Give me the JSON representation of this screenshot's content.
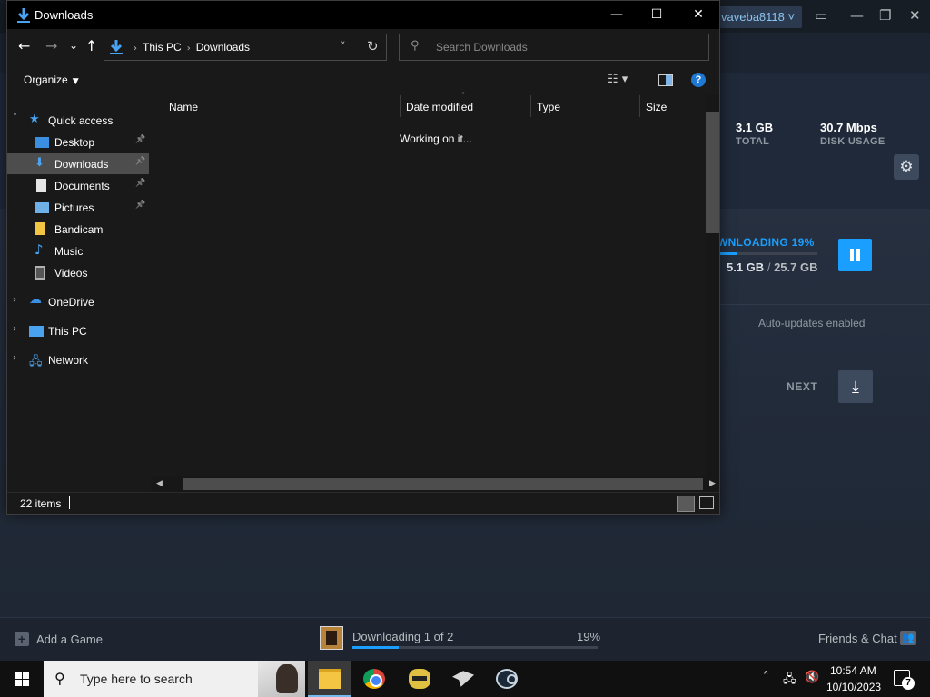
{
  "steam": {
    "username": "vaveba8118",
    "window_controls": [
      "—",
      "❐",
      "✕"
    ],
    "stats": [
      {
        "value": "3.1 GB",
        "label": "TOTAL"
      },
      {
        "value": "30.7 Mbps",
        "label": "DISK USAGE"
      }
    ],
    "downloading_label": "WNLOADING 19%",
    "downloaded_size": "5.1 GB",
    "size_separator": "/",
    "total_size": "25.7 GB",
    "progress_fraction": 0.19,
    "auto_updates": "Auto-updates enabled",
    "next_label": "NEXT",
    "bottom": {
      "add_game": "Add a Game",
      "downloading_status": "Downloading 1 of 2",
      "percent": "19%",
      "friends_chat": "Friends & Chat"
    },
    "colors": {
      "accent": "#1a9fff",
      "bg": "#222b3a"
    }
  },
  "explorer": {
    "title": "Downloads",
    "controls": {
      "minimize": "—",
      "maximize": "☐",
      "close": "✕"
    },
    "nav": {
      "back": "←",
      "forward": "→",
      "recent": "⌄",
      "up": "↑"
    },
    "address": {
      "crumbs": [
        "This PC",
        "Downloads"
      ]
    },
    "search_placeholder": "Search Downloads",
    "organize_label": "Organize",
    "nav_pane": [
      {
        "label": "Quick access",
        "icon": "star-icon",
        "chevron": "˅",
        "indent": 0
      },
      {
        "label": "Desktop",
        "icon": "desktop-icon",
        "pinned": true,
        "indent": 1
      },
      {
        "label": "Downloads",
        "icon": "download-arrow-icon",
        "pinned": true,
        "indent": 1,
        "selected": true
      },
      {
        "label": "Documents",
        "icon": "document-icon",
        "pinned": true,
        "indent": 1
      },
      {
        "label": "Pictures",
        "icon": "pictures-icon",
        "pinned": true,
        "indent": 1
      },
      {
        "label": "Bandicam",
        "icon": "folder-icon",
        "indent": 1
      },
      {
        "label": "Music",
        "icon": "music-note-icon",
        "indent": 1
      },
      {
        "label": "Videos",
        "icon": "film-icon",
        "indent": 1
      },
      {
        "label": "OneDrive",
        "icon": "cloud-icon",
        "chevron": "›",
        "indent": 0
      },
      {
        "label": "This PC",
        "icon": "computer-icon",
        "chevron": "›",
        "indent": 0
      },
      {
        "label": "Network",
        "icon": "network-icon",
        "chevron": "›",
        "indent": 0
      }
    ],
    "columns": [
      "Name",
      "Date modified",
      "Type",
      "Size"
    ],
    "working_text": "Working on it...",
    "item_count": "22 items"
  },
  "taskbar": {
    "search_placeholder": "Type here to search",
    "apps": [
      "file-explorer-icon",
      "chrome-icon",
      "bee-app-icon",
      "hawk-app-icon",
      "steam-icon"
    ],
    "time": "10:54 AM",
    "date": "10/10/2023",
    "notification_count": "7"
  }
}
